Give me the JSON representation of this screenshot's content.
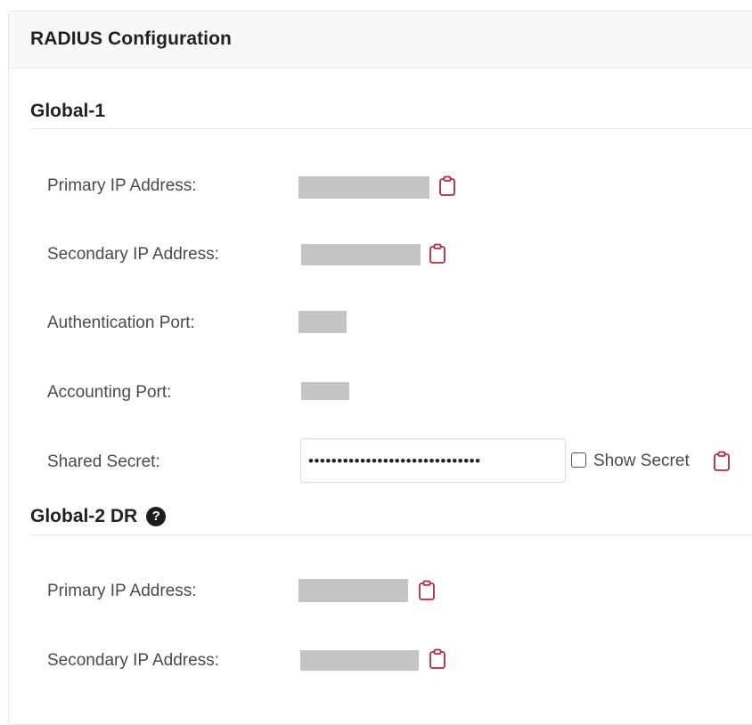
{
  "panel": {
    "title": "RADIUS Configuration"
  },
  "global1": {
    "title": "Global-1",
    "primary_ip_label": "Primary IP Address:",
    "secondary_ip_label": "Secondary IP Address:",
    "auth_port_label": "Authentication Port:",
    "acct_port_label": "Accounting Port:",
    "shared_secret_label": "Shared Secret:",
    "shared_secret_value": "••••••••••••••••••••••••••••••",
    "show_secret_label": "Show Secret",
    "show_secret_checked": false
  },
  "global2": {
    "title": "Global-2 DR",
    "primary_ip_label": "Primary IP Address:",
    "secondary_ip_label": "Secondary IP Address:"
  },
  "icons": {
    "copy": "clipboard-icon",
    "help": "question-circle-icon"
  },
  "colors": {
    "accent": "#b02a37",
    "redacted": "#c4c4c4",
    "header_bg": "#f8f8f8"
  }
}
